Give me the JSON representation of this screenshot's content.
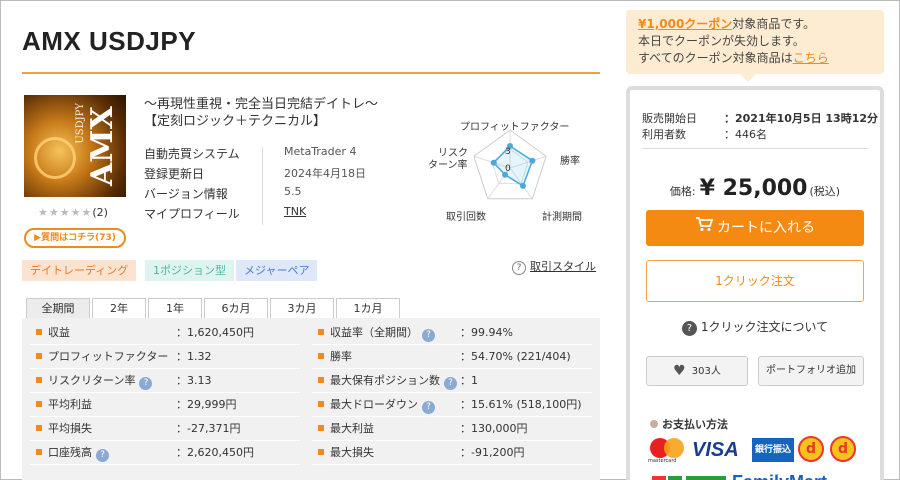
{
  "product": {
    "title": "AMX USDJPY",
    "thumb_text": "AMX",
    "thumb_sub": "USDJPY",
    "stars": "★★★★★",
    "review_count": "(2)",
    "qa_button": "質問はコチラ(73)",
    "tagline_line1": "～再現性重視・完全当日完結デイトレ～",
    "tagline_line2": "【定刻ロジック＋テクニカル】"
  },
  "info": [
    {
      "key": "自動売買システム",
      "value": "MetaTrader 4"
    },
    {
      "key": "登録更新日",
      "value": "2024年4月18日"
    },
    {
      "key": "バージョン情報",
      "value": "5.5"
    },
    {
      "key": "マイプロフィール",
      "value": "TNK"
    }
  ],
  "radar": {
    "labels": {
      "pf": "プロフィットファクター",
      "win": "勝率",
      "period": "計測期間",
      "trades": "取引回数",
      "risk_line1": "リスク",
      "risk_line2": "ターン率"
    },
    "scale_labels": [
      "3",
      "0"
    ],
    "values": [
      0.58,
      0.62,
      0.58,
      0.22,
      0.45
    ]
  },
  "tags": [
    "デイトレーディング",
    "1ポジション型",
    "メジャーペア"
  ],
  "trade_style": "取引スタイル",
  "tabs": [
    "全期間",
    "2年",
    "1年",
    "6カ月",
    "3カ月",
    "1カ月"
  ],
  "stats_left": [
    {
      "label": "収益",
      "value": "：1,620,450円",
      "help": false
    },
    {
      "label": "プロフィットファクター",
      "value": "：1.32",
      "help": false
    },
    {
      "label": "リスクリターン率",
      "value": "：3.13",
      "help": true
    },
    {
      "label": "平均利益",
      "value": "：29,999円",
      "help": false
    },
    {
      "label": "平均損失",
      "value": "：-27,371円",
      "help": false
    },
    {
      "label": "口座残高",
      "value": "：2,620,450円",
      "help": true
    }
  ],
  "stats_right": [
    {
      "label": "収益率（全期間）",
      "value": "：99.94%",
      "help": true
    },
    {
      "label": "勝率",
      "value": "：54.70% (221/404)",
      "help": false
    },
    {
      "label": "最大保有ポジション数",
      "value": "：1",
      "help": true
    },
    {
      "label": "最大ドローダウン",
      "value": "：15.61% (518,100円)",
      "help": true
    },
    {
      "label": "最大利益",
      "value": "：130,000円",
      "help": false
    },
    {
      "label": "最大損失",
      "value": "：-91,200円",
      "help": false
    }
  ],
  "coupon": {
    "highlight": "¥1,000クーポン",
    "line1_rest": "対象商品です。",
    "line2": "本日でクーポンが失効します。",
    "line3": "すべてのクーポン対象商品は",
    "link": "こちら"
  },
  "sidebar": {
    "release_label": "販売開始日",
    "release_value": "：2021年10月5日 13時12分",
    "users_label": "利用者数",
    "users_value": "：446名",
    "price_label": "価格:",
    "price_value": "¥ 25,000",
    "price_tax": "(税込)",
    "cart_button": "カートに入れる",
    "oneclick_button": "1クリック注文",
    "oneclick_help": "1クリック注文について",
    "favorites": "303人",
    "portfolio_button": "ポートフォリオ追加",
    "payment_title": "お支払い方法",
    "mastercard_text": "mastercard",
    "visa_text": "VISA",
    "bank_text": "銀行振込",
    "pay_d": "d",
    "familymart_text": "FamilyMart"
  },
  "colors": {
    "accent": "#f58a12",
    "coupon_bg": "#fdecd2",
    "stat_bg": "#f1f1f1"
  },
  "icons": {
    "cart": "cart-icon",
    "heart": "heart-icon",
    "help": "question-icon"
  }
}
